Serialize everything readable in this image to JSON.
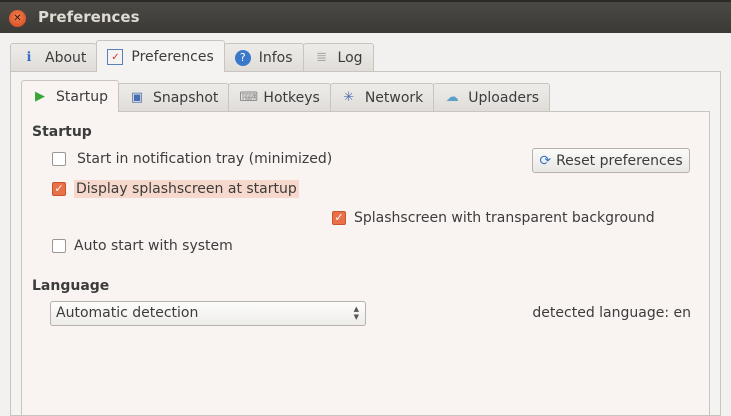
{
  "window": {
    "title": "Preferences"
  },
  "outer_tabs": [
    {
      "label": "About",
      "icon": "info-icon"
    },
    {
      "label": "Preferences",
      "icon": "checklist-icon"
    },
    {
      "label": "Infos",
      "icon": "help-icon"
    },
    {
      "label": "Log",
      "icon": "log-icon"
    }
  ],
  "inner_tabs": [
    {
      "label": "Startup",
      "icon": "play-icon"
    },
    {
      "label": "Snapshot",
      "icon": "snapshot-icon"
    },
    {
      "label": "Hotkeys",
      "icon": "key-icon"
    },
    {
      "label": "Network",
      "icon": "network-icon"
    },
    {
      "label": "Uploaders",
      "icon": "cloud-upload-icon"
    }
  ],
  "startup": {
    "heading": "Startup",
    "tray": {
      "label": "Start in notification tray (minimized)",
      "checked": false
    },
    "splash": {
      "label": "Display splashscreen at startup",
      "checked": true
    },
    "splash_transparent": {
      "label": "Splashscreen with transparent background",
      "checked": true
    },
    "autostart": {
      "label": "Auto start with system",
      "checked": false
    },
    "reset_label": "Reset preferences"
  },
  "language": {
    "heading": "Language",
    "selected": "Automatic detection",
    "detected": "detected language: en"
  }
}
